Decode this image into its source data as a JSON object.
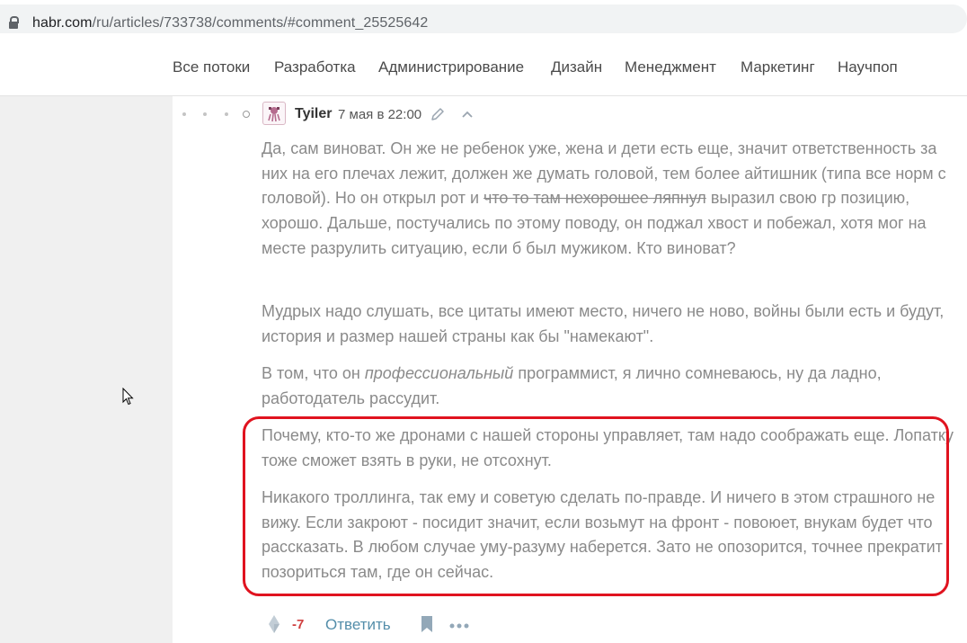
{
  "browser": {
    "url_host": "habr.com",
    "url_path": "/ru/articles/733738/comments/#comment_25525642"
  },
  "nav": {
    "items": [
      "Все потоки",
      "Разработка",
      "Администрирование",
      "Дизайн",
      "Менеджмент",
      "Маркетинг",
      "Научпоп"
    ]
  },
  "comment": {
    "author": "Tyiler",
    "date": "7 мая в 22:00",
    "paragraphs": {
      "p1_a": "Да, сам виноват. Он же не ребенок уже, жена и дети есть еще, значит ответственность за них на его плечах лежит, должен же думать головой, тем более айтишник (типа все норм с головой). Но он открыл рот и ",
      "p1_strike": "что то там нехорошее ляпнул",
      "p1_b": " выразил свою гр позицию, хорошо. Дальше, постучались по этому поводу, он поджал хвост и побежал, хотя мог на месте разрулить ситуацию, если б был мужиком. Кто виноват?",
      "p2": "Мудрых надо слушать, все цитаты имеют место, ничего не ново, войны были есть и будут, история и размер нашей страны как бы \"намекают\".",
      "p3_a": "В том, что он ",
      "p3_em": "профессиональный",
      "p3_b": " программист, я лично сомневаюсь, ну да ладно, работодатель рассудит.",
      "p4": "Почему, кто-то же дронами с нашей стороны управляет, там надо соображать еще. Лопатку тоже сможет взять в руки, не отсохнут.",
      "p5": "Никакого троллинга, так ему и советую сделать по-правде. И ничего в этом страшного не вижу. Если закроют - посидит значит, если возьмут на фронт - повоюет, внукам будет что рассказать. В любом случае уму-разуму наберется. Зато не опозорится, точнее прекратит позориться там, где он сейчас."
    },
    "score": "-7",
    "reply_label": "Ответить"
  },
  "icons": {
    "lock": "lock-icon",
    "edit": "pencil-icon",
    "up": "chevron-up-icon",
    "vote": "vote-diamond-icon",
    "bookmark": "bookmark-icon",
    "more": "more-dots-icon",
    "cursor": "mouse-cursor-icon"
  },
  "colors": {
    "highlight": "#e0131f",
    "score": "#d04040",
    "link": "#548eaa",
    "text_muted": "#8a8a8a"
  }
}
